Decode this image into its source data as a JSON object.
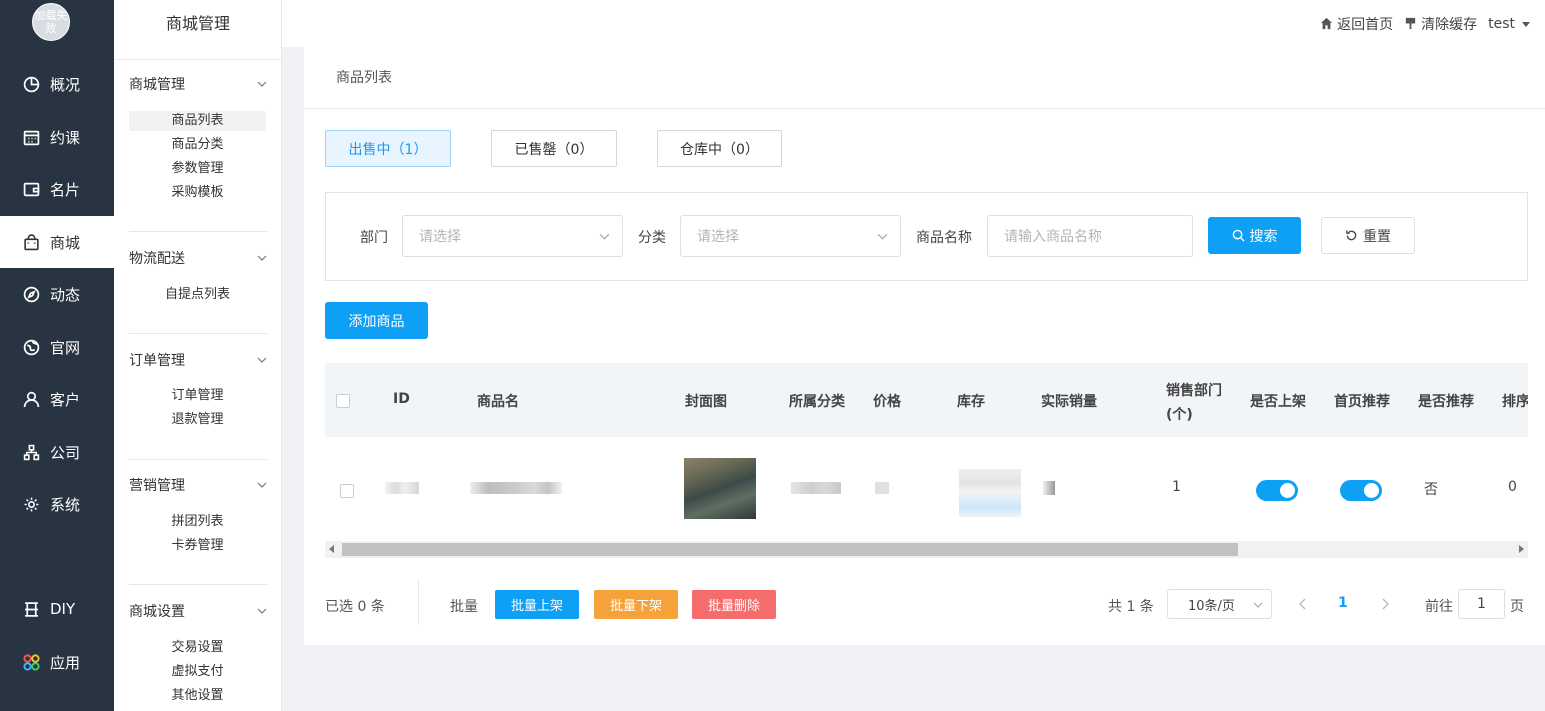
{
  "sidebar": {
    "logo_text": "加载失败",
    "items": [
      {
        "label": "概况",
        "icon": "chart-pie-icon"
      },
      {
        "label": "约课",
        "icon": "calendar-icon"
      },
      {
        "label": "名片",
        "icon": "wallet-icon"
      },
      {
        "label": "商城",
        "icon": "shopping-bag-icon",
        "active": true
      },
      {
        "label": "动态",
        "icon": "compass-icon"
      },
      {
        "label": "官网",
        "icon": "globe-icon"
      },
      {
        "label": "客户",
        "icon": "user-icon"
      },
      {
        "label": "公司",
        "icon": "org-chart-icon"
      },
      {
        "label": "系统",
        "icon": "gear-icon"
      },
      {
        "label": "DIY",
        "icon": "diy-icon"
      },
      {
        "label": "应用",
        "icon": "apps-icon"
      }
    ]
  },
  "submenu": {
    "title": "商城管理",
    "groups": [
      {
        "label": "商城管理",
        "items": [
          "商品列表",
          "商品分类",
          "参数管理",
          "采购模板"
        ]
      },
      {
        "label": "物流配送",
        "items": [
          "自提点列表"
        ]
      },
      {
        "label": "订单管理",
        "items": [
          "订单管理",
          "退款管理"
        ]
      },
      {
        "label": "营销管理",
        "items": [
          "拼团列表",
          "卡券管理"
        ]
      },
      {
        "label": "商城设置",
        "items": [
          "交易设置",
          "虚拟支付",
          "其他设置"
        ]
      }
    ]
  },
  "topbar": {
    "home": "返回首页",
    "clear_cache": "清除缓存",
    "user": "test"
  },
  "main": {
    "breadcrumb": "商品列表",
    "tabs": [
      "出售中（1）",
      "已售罄（0）",
      "仓库中（0）"
    ],
    "filter": {
      "dept_label": "部门",
      "dept_placeholder": "请选择",
      "category_label": "分类",
      "category_placeholder": "请选择",
      "name_label": "商品名称",
      "name_placeholder": "请输入商品名称",
      "search": "搜索",
      "reset": "重置"
    },
    "add_button": "添加商品",
    "table": {
      "columns": [
        "ID",
        "商品名",
        "封面图",
        "所属分类",
        "价格",
        "库存",
        "实际销量",
        "销售部门(个)",
        "是否上架",
        "首页推荐",
        "是否推荐",
        "排序"
      ],
      "rows": [
        {
          "sales_dept": "1",
          "on_shelf": true,
          "home_recommend": true,
          "recommend": "否",
          "sort": "0"
        }
      ]
    },
    "footer": {
      "selected": "已选 0 条",
      "batch": "批量",
      "batch_on": "批量上架",
      "batch_off": "批量下架",
      "batch_delete": "批量删除",
      "total": "共 1 条",
      "page_size": "10条/页",
      "page": "1",
      "goto": "前往",
      "goto_value": "1",
      "page_unit": "页"
    }
  },
  "colors": {
    "nav_bg": "#283441",
    "primary": "#0ea0f4",
    "warning": "#f5a23a",
    "danger": "#f56c6c"
  }
}
